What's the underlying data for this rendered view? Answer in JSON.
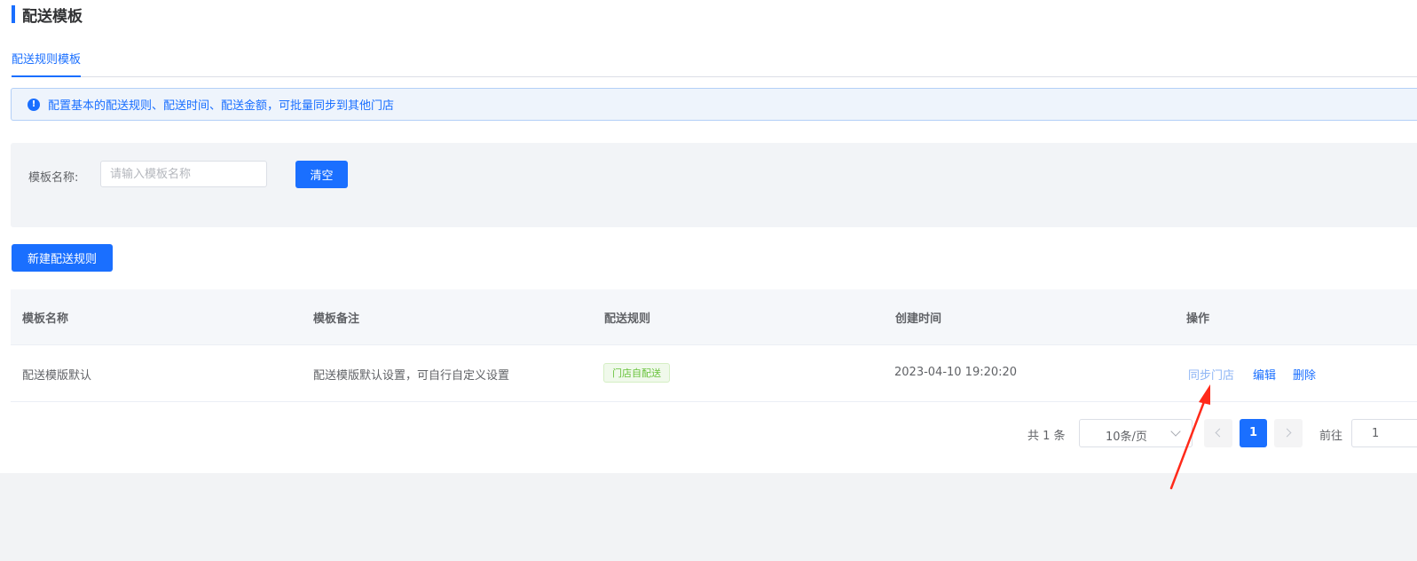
{
  "page": {
    "title": "配送模板"
  },
  "tabs": [
    {
      "label": "配送规则模板",
      "active": true
    }
  ],
  "notice": {
    "icon": "info-icon",
    "text": "配置基本的配送规则、配送时间、配送金额，可批量同步到其他门店"
  },
  "filter": {
    "label": "模板名称:",
    "placeholder": "请输入模板名称",
    "value": "",
    "clear_label": "清空"
  },
  "actions": {
    "create_label": "新建配送规则"
  },
  "table": {
    "columns": [
      "模板名称",
      "模板备注",
      "配送规则",
      "创建时间",
      "操作"
    ],
    "rows": [
      {
        "name": "配送模版默认",
        "remark": "配送模版默认设置，可自行自定义设置",
        "rule_tag": "门店自配送",
        "created_at": "2023-04-10 19:20:20",
        "ops": {
          "sync": "同步门店",
          "edit": "编辑",
          "delete": "删除"
        }
      }
    ]
  },
  "pagination": {
    "total_text": "共 1 条",
    "page_size": "10条/页",
    "current_page": "1",
    "goto_label": "前往",
    "goto_value": "1"
  },
  "colors": {
    "primary": "#1a6fff",
    "tag_green": "#67c23a",
    "annotation_arrow": "#ff2a1a"
  }
}
